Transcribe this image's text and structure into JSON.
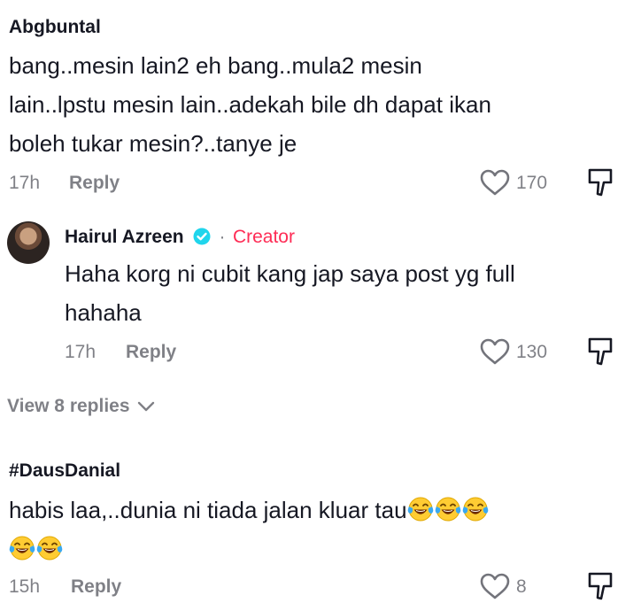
{
  "comments": [
    {
      "username": "Abgbuntal",
      "lines": [
        "bang..mesin lain2 eh bang..mula2 mesin",
        "lain..lpstu mesin lain..adekah bile dh dapat ikan",
        "boleh tukar mesin?..tanye je"
      ],
      "time": "17h",
      "reply_label": "Reply",
      "likes": "170"
    },
    {
      "username": "#DausDanial",
      "text": "habis laa,..dunia ni tiada jalan kluar tau",
      "emoji_icon": "face-with-tears-of-joy-icon",
      "time": "15h",
      "reply_label": "Reply",
      "likes": "8"
    }
  ],
  "reply": {
    "username": "Hairul Azreen",
    "badge": "Creator",
    "dot": "·",
    "lines": [
      "Haha korg ni cubit kang jap saya post yg full",
      "hahaha"
    ],
    "time": "17h",
    "reply_label": "Reply",
    "likes": "130"
  },
  "view_replies": "View 8 replies",
  "colors": {
    "creator": "#fe2c55",
    "verified": "#20d5ec",
    "text": "#161823",
    "emoji_face": "#ffcc33",
    "emoji_tear": "#3aa9f0"
  }
}
